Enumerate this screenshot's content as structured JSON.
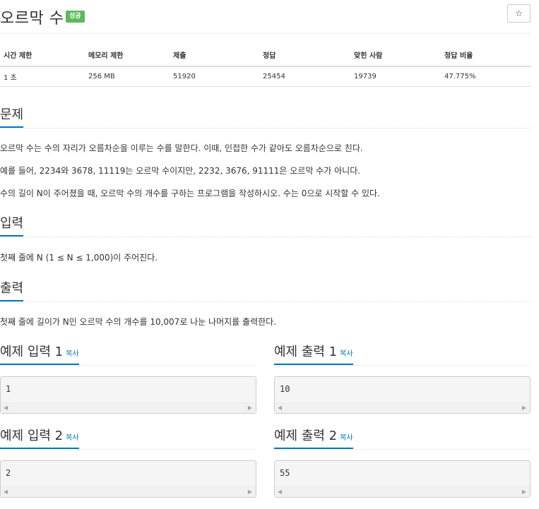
{
  "problem": {
    "title": "오르막 수",
    "status_badge": "성공",
    "star_icon": "☆"
  },
  "info_table": {
    "headers": [
      "시간 제한",
      "메모리 제한",
      "제출",
      "정답",
      "맞힌 사람",
      "정답 비율"
    ],
    "values": [
      "1 초",
      "256 MB",
      "51920",
      "25454",
      "19739",
      "47.775%"
    ]
  },
  "sections": {
    "problem": {
      "heading": "문제",
      "paragraphs": [
        "오르막 수는 수의 자리가 오름차순을 이루는 수를 말한다. 이때, 인접한 수가 같아도 오름차순으로 친다.",
        "예를 들어, 2234와 3678, 11119는 오르막 수이지만, 2232, 3676, 91111은 오르막 수가 아니다.",
        "수의 길이 N이 주어졌을 때, 오르막 수의 개수를 구하는 프로그램을 작성하시오. 수는 0으로 시작할 수 있다."
      ]
    },
    "input": {
      "heading": "입력",
      "text": "첫째 줄에 N (1 ≤ N ≤ 1,000)이 주어진다."
    },
    "output": {
      "heading": "출력",
      "text": "첫째 줄에 길이가 N인 오르막 수의 개수를 10,007로 나눈 나머지를 출력한다."
    }
  },
  "examples": {
    "copy_label": "복사",
    "input1": {
      "heading": "예제 입력 1",
      "value": "1"
    },
    "output1": {
      "heading": "예제 출력 1",
      "value": "10"
    },
    "input2": {
      "heading": "예제 입력 2",
      "value": "2"
    },
    "output2": {
      "heading": "예제 출력 2",
      "value": "55"
    }
  },
  "scroll_arrows": {
    "left": "◀",
    "right": "▶"
  }
}
